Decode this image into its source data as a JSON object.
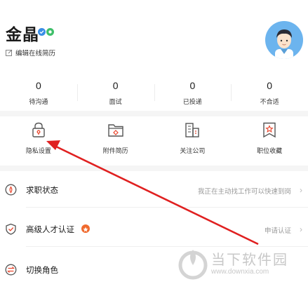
{
  "profile": {
    "name": "金晶",
    "edit_label": "编辑在线简历"
  },
  "stats": [
    {
      "value": "0",
      "label": "待沟通"
    },
    {
      "value": "0",
      "label": "面试"
    },
    {
      "value": "0",
      "label": "已投递"
    },
    {
      "value": "0",
      "label": "不合适"
    }
  ],
  "tools": [
    {
      "label": "隐私设置",
      "icon": "lock-icon"
    },
    {
      "label": "附件简历",
      "icon": "folder-icon"
    },
    {
      "label": "关注公司",
      "icon": "building-icon"
    },
    {
      "label": "职位收藏",
      "icon": "star-bookmark-icon"
    }
  ],
  "rows": [
    {
      "label": "求职状态",
      "value": "我正在主动找工作可以快速到岗",
      "icon": "job-status-icon"
    },
    {
      "label": "高级人才认证",
      "value": "申请认证",
      "icon": "shield-check-icon"
    },
    {
      "label": "切换角色",
      "value": "",
      "icon": "switch-role-icon"
    }
  ],
  "watermark": {
    "title": "当下软件园",
    "url": "www.downxia.com"
  },
  "colors": {
    "accent": "#e8452c",
    "arrow": "#e02020",
    "badge_blue": "#3a8ee6",
    "badge_green": "#3fbf6a",
    "avatar_bg": "#6cb4ee"
  }
}
